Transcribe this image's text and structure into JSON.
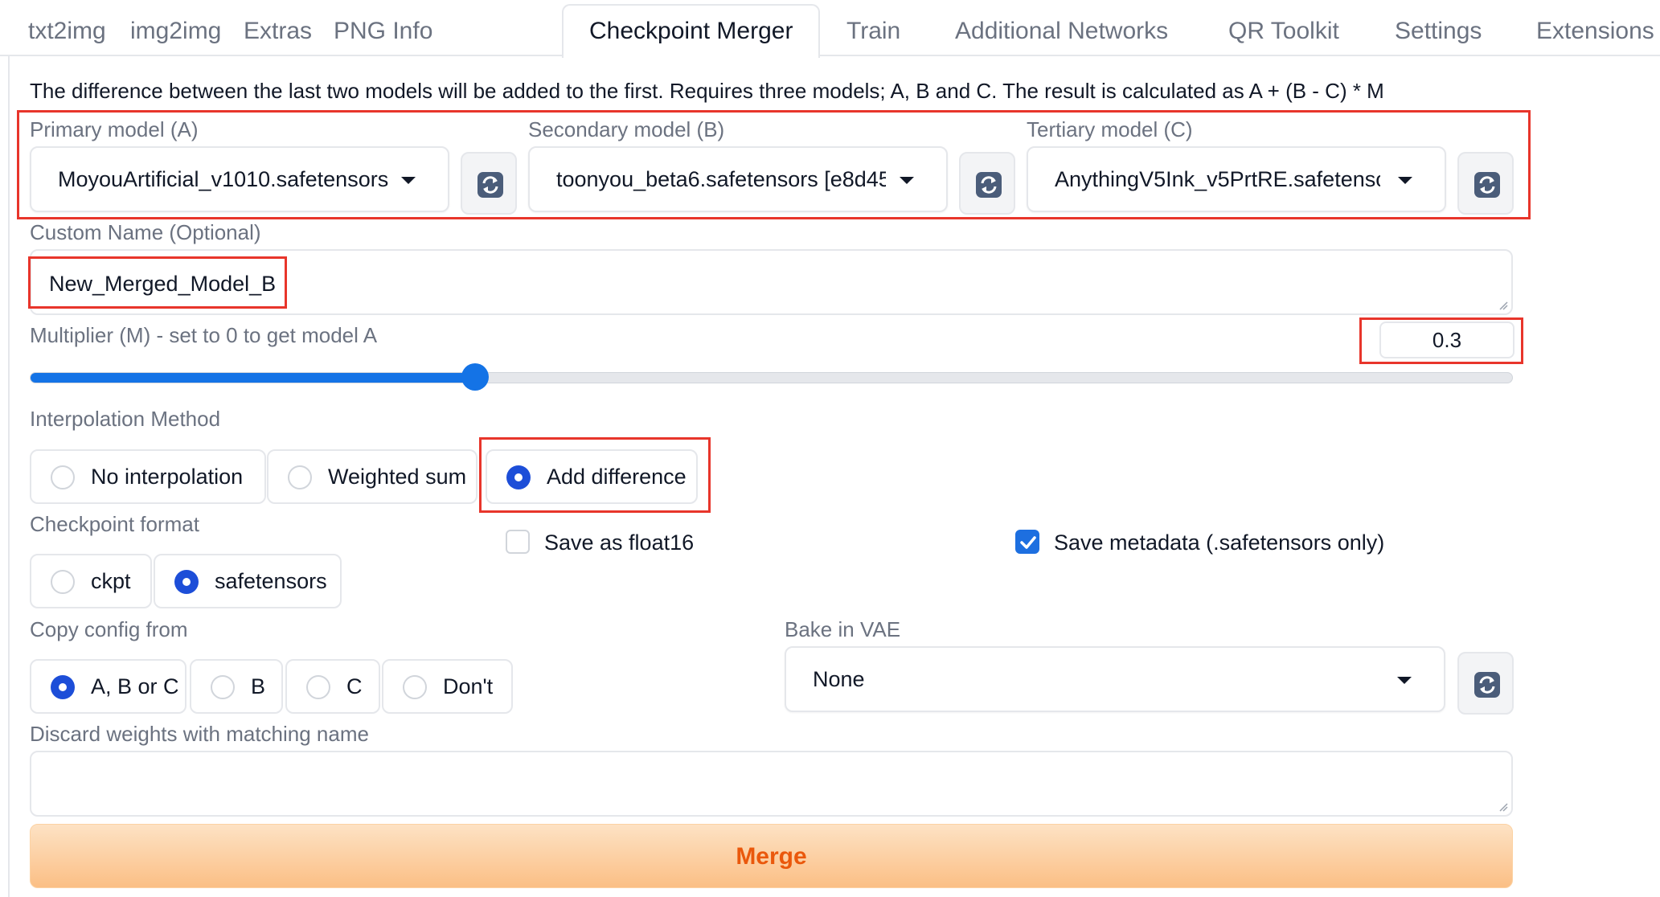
{
  "tabs": [
    {
      "label": "txt2img"
    },
    {
      "label": "img2img"
    },
    {
      "label": "Extras"
    },
    {
      "label": "PNG Info"
    },
    {
      "label": "Checkpoint Merger",
      "active": true
    },
    {
      "label": "Train"
    },
    {
      "label": "Additional Networks"
    },
    {
      "label": "QR Toolkit"
    },
    {
      "label": "Settings"
    },
    {
      "label": "Extensions"
    }
  ],
  "description": "The difference between the last two models will be added to the first. Requires three models; A, B and C. The result is calculated as A + (B - C) * M",
  "models": {
    "primary": {
      "label": "Primary model (A)",
      "value": "MoyouArtificial_v1010.safetensors"
    },
    "secondary": {
      "label": "Secondary model (B)",
      "value": "toonyou_beta6.safetensors [e8d45"
    },
    "tertiary": {
      "label": "Tertiary model (C)",
      "value": "AnythingV5Ink_v5PrtRE.safetensor"
    }
  },
  "custom_name": {
    "label": "Custom Name (Optional)",
    "value": "New_Merged_Model_B"
  },
  "multiplier": {
    "label": "Multiplier (M) - set to 0 to get model A",
    "value": "0.3",
    "fraction": 0.3
  },
  "interpolation": {
    "label": "Interpolation Method",
    "options": [
      "No interpolation",
      "Weighted sum",
      "Add difference"
    ],
    "selected": "Add difference"
  },
  "checkpoint_format": {
    "label": "Checkpoint format",
    "options": [
      "ckpt",
      "safetensors"
    ],
    "selected": "safetensors"
  },
  "save_float16": {
    "label": "Save as float16",
    "checked": false
  },
  "save_metadata": {
    "label": "Save metadata (.safetensors only)",
    "checked": true
  },
  "copy_config": {
    "label": "Copy config from",
    "options": [
      "A, B or C",
      "B",
      "C",
      "Don't"
    ],
    "selected": "A, B or C"
  },
  "bake_vae": {
    "label": "Bake in VAE",
    "value": "None"
  },
  "discard_weights": {
    "label": "Discard weights with matching name",
    "value": ""
  },
  "merge_button": {
    "label": "Merge"
  },
  "icons": {
    "refresh": "refresh-icon",
    "caret": "caret-down-icon",
    "check": "check-icon"
  },
  "colors": {
    "accent": "#1473e6",
    "highlight": "#e8352b",
    "merge_text": "#ea580c"
  }
}
